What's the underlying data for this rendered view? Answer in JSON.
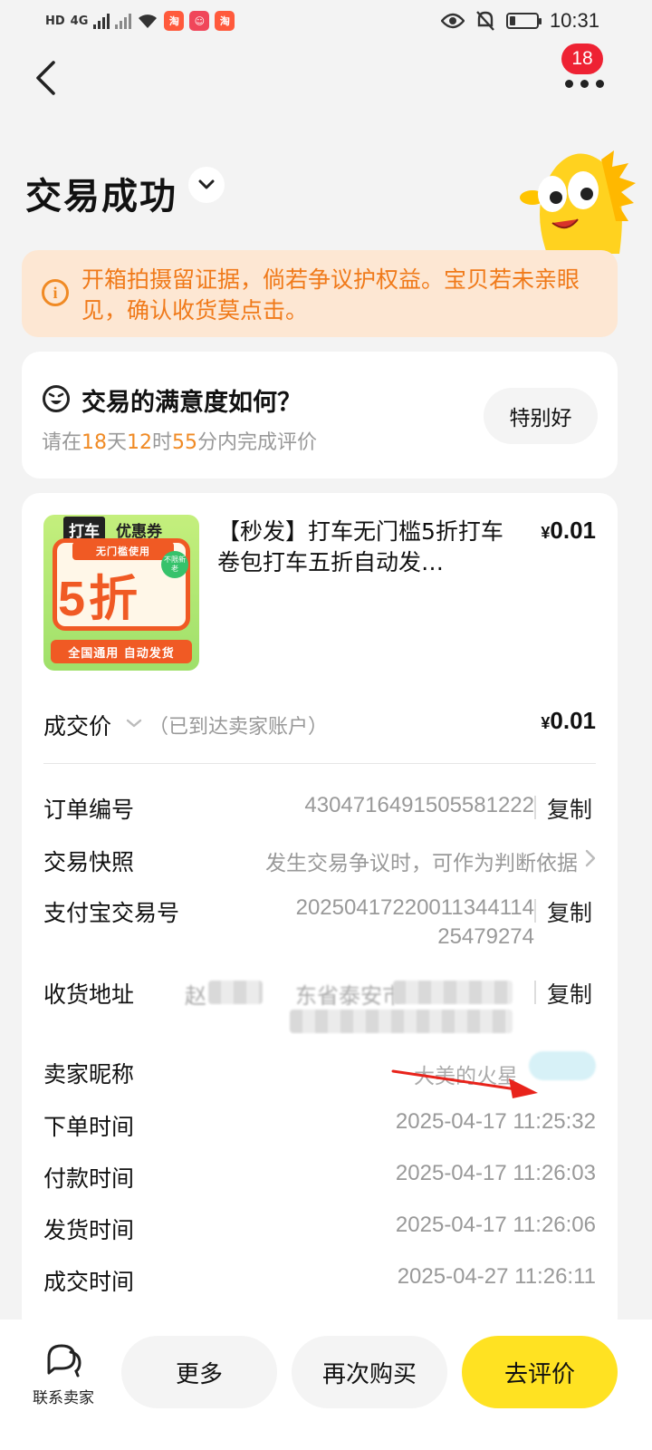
{
  "status_bar": {
    "hd_label": "HD",
    "net_label": "4G",
    "app_icon_char": "淘",
    "time": "10:31"
  },
  "header": {
    "badge_count": "18",
    "title": "交易成功"
  },
  "notice": {
    "text": "开箱拍摄留证据，倘若争议护权益。宝贝若未亲眼见，确认收货莫点击。"
  },
  "satisfaction": {
    "title": "交易的满意度如何？",
    "sub_prefix": "请在",
    "days": "18",
    "days_unit": "天",
    "hours": "12",
    "hours_unit": "时",
    "minutes": "55",
    "minutes_unit": "分内完成评价",
    "button": "特别好"
  },
  "product": {
    "image_tag_1": "打车",
    "image_tag_2": "优惠券",
    "image_strip": "无门槛使用",
    "image_big": "5折",
    "image_stamp": "不限新老",
    "image_bottom": "全国通用 自动发货",
    "title": "【秒发】打车无门槛5折打车卷包打车五折自动发…",
    "currency": "¥",
    "price": "0.01"
  },
  "deal": {
    "label": "成交价",
    "note": "（已到达卖家账户）",
    "currency": "¥",
    "price": "0.01"
  },
  "details": {
    "order_no_label": "订单编号",
    "order_no": "4304716491505581222",
    "snapshot_label": "交易快照",
    "snapshot_value": "发生交易争议时，可作为判断依据",
    "alipay_label": "支付宝交易号",
    "alipay_line1": "20250417220011344114",
    "alipay_line2": "25479274",
    "address_label": "收货地址",
    "address_visible": "赵",
    "address_visible_2": "东省泰安市",
    "seller_label": "卖家昵称",
    "seller_value": "大美的火星",
    "order_time_label": "下单时间",
    "order_time": "2025-04-17 11:25:32",
    "pay_time_label": "付款时间",
    "pay_time": "2025-04-17 11:26:03",
    "ship_time_label": "发货时间",
    "ship_time": "2025-04-17 11:26:06",
    "deal_time_label": "成交时间",
    "deal_time": "2025-04-27 11:26:11",
    "copy": "复制"
  },
  "bottom_bar": {
    "contact": "联系卖家",
    "more": "更多",
    "rebuy": "再次购买",
    "review": "去评价"
  },
  "colors": {
    "accent_yellow": "#ffe222",
    "notice_bg": "#fde7d3",
    "notice_text": "#f07a1a",
    "badge_red": "#ee2233",
    "arrow_red": "#e8231b"
  }
}
